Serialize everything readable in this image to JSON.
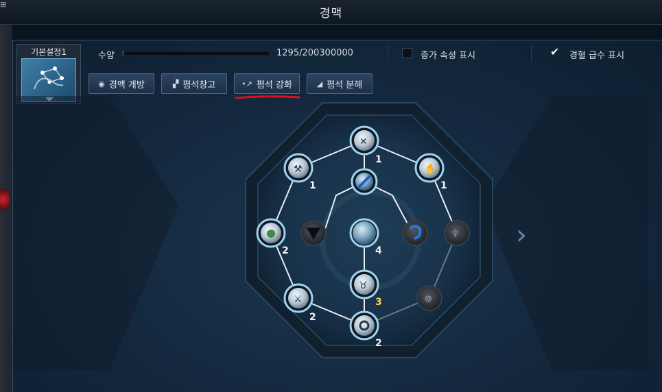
{
  "window": {
    "title": "경맥"
  },
  "preset": {
    "label": "기본설정1"
  },
  "stats": {
    "label": "수양",
    "progress_text": "1295/200300000",
    "progress_fraction": 6.5e-06
  },
  "options": [
    {
      "label": "증가 속성 표시",
      "checked": false
    },
    {
      "label": "경혈 급수 표시",
      "checked": true
    }
  ],
  "toolbar": {
    "open_label": "경맥 개방",
    "storage_label": "폄석창고",
    "enhance_label": "폄석 강화",
    "decompose_label": "폄석 분해"
  },
  "nodes": [
    {
      "id": "top",
      "level": "1",
      "icon": "crossed-tools-icon",
      "active": true
    },
    {
      "id": "upper-left",
      "level": "1",
      "icon": "pickaxe-icon",
      "active": true
    },
    {
      "id": "upper-right",
      "level": "1",
      "icon": "gauntlet-icon",
      "active": true
    },
    {
      "id": "center-top",
      "level": "",
      "icon": "bone-icon",
      "active": true
    },
    {
      "id": "left",
      "level": "2",
      "icon": "hand-icon",
      "active": true
    },
    {
      "id": "inner-left",
      "level": "",
      "icon": "shield-icon",
      "active": false
    },
    {
      "id": "center",
      "level": "4",
      "icon": "orb-icon",
      "active": true
    },
    {
      "id": "inner-right",
      "level": "",
      "icon": "swirl-icon",
      "active": false
    },
    {
      "id": "right",
      "level": "",
      "icon": "wings-icon",
      "active": false
    },
    {
      "id": "center-bottom",
      "level": "3",
      "icon": "horned-beast-icon",
      "active": true
    },
    {
      "id": "lower-left",
      "level": "2",
      "icon": "crossed-blades-icon",
      "active": true
    },
    {
      "id": "lower-right",
      "level": "",
      "icon": "beast-head-icon",
      "active": false
    },
    {
      "id": "bottom",
      "level": "2",
      "icon": "target-icon",
      "active": true
    }
  ],
  "colors": {
    "accent": "#9fd4f0",
    "highlight_underline": "#e0101a",
    "level_gold": "#ffd94a"
  }
}
